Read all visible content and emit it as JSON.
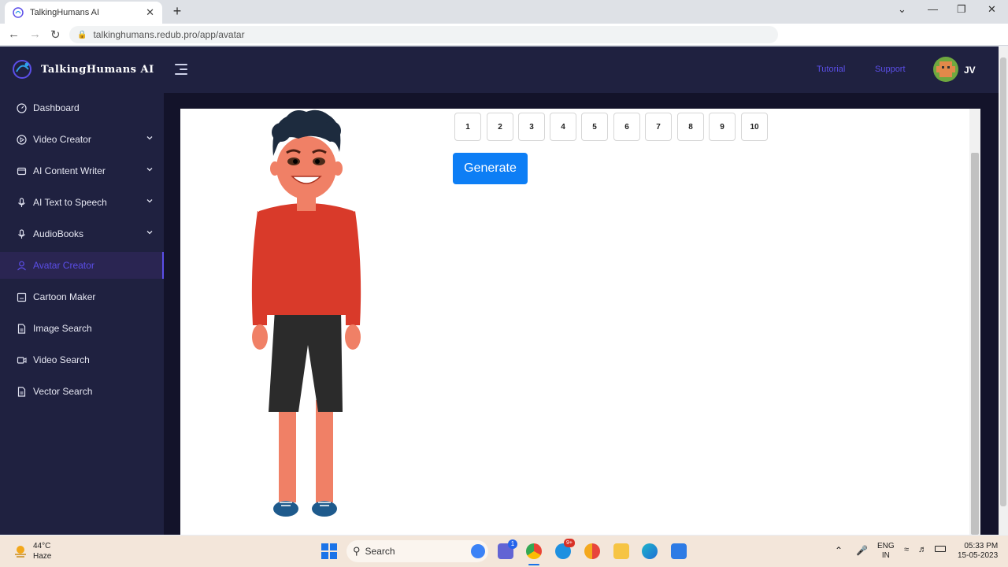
{
  "browser": {
    "tab_title": "TalkingHumans AI",
    "tab_close": "✕",
    "new_tab": "+",
    "url": "talkinghumans.redub.pro/app/avatar",
    "win_minimize": "—",
    "win_restore": "❐",
    "win_close": "✕",
    "tab_search": "⌄"
  },
  "app": {
    "brand": "TalkingHumans AI",
    "topnav": {
      "tutorial": "Tutorial",
      "support": "Support",
      "user_initials": "JV"
    },
    "sidebar": {
      "items": [
        {
          "label": "Dashboard",
          "icon": "dashboard-icon",
          "has_chevron": false
        },
        {
          "label": "Video Creator",
          "icon": "play-circle-icon",
          "has_chevron": true
        },
        {
          "label": "AI Content Writer",
          "icon": "mail-icon",
          "has_chevron": true
        },
        {
          "label": "AI Text to Speech",
          "icon": "microphone-icon",
          "has_chevron": true
        },
        {
          "label": "AudioBooks",
          "icon": "microphone-icon",
          "has_chevron": true
        },
        {
          "label": "Avatar Creator",
          "icon": "user-icon",
          "has_chevron": false,
          "active": true
        },
        {
          "label": "Cartoon Maker",
          "icon": "image-frame-icon",
          "has_chevron": false
        },
        {
          "label": "Image Search",
          "icon": "file-icon",
          "has_chevron": false
        },
        {
          "label": "Video Search",
          "icon": "video-icon",
          "has_chevron": false
        },
        {
          "label": "Vector Search",
          "icon": "file-icon",
          "has_chevron": false
        }
      ]
    },
    "main": {
      "number_buttons": [
        "1",
        "2",
        "3",
        "4",
        "5",
        "6",
        "7",
        "8",
        "9",
        "10"
      ],
      "generate_label": "Generate"
    },
    "colors": {
      "accent": "#5b4ee8",
      "sidebar_bg": "#1f2140",
      "generate_bg": "#0d7ef5"
    }
  },
  "taskbar": {
    "weather_temp": "44°C",
    "weather_desc": "Haze",
    "search_placeholder": "Search",
    "lang_top": "ENG",
    "lang_bottom": "IN",
    "time": "05:33 PM",
    "date": "15-05-2023",
    "chat_badge": "1",
    "skype_badge": "9+"
  }
}
